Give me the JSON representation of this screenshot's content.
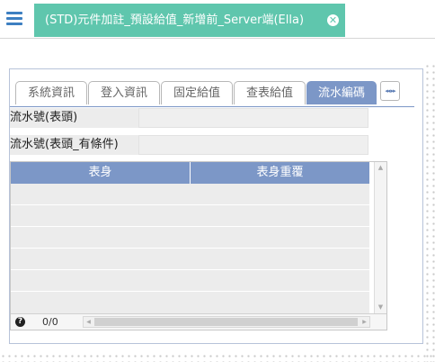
{
  "header": {
    "menu_icon": "hamburger-menu-icon",
    "tab_title": "(STD)元件加註_預設給值_新增前_Server端(Ella)",
    "close_icon": "close-circle-icon"
  },
  "tabs": [
    {
      "label": "系統資訊",
      "active": false
    },
    {
      "label": "登入資訊",
      "active": false
    },
    {
      "label": "固定給值",
      "active": false
    },
    {
      "label": "查表給值",
      "active": false
    },
    {
      "label": "流水編碼",
      "active": true
    }
  ],
  "tab_nav": {
    "arrows": "◂◂ ▸▸"
  },
  "fields": [
    {
      "label": "流水號(表頭)",
      "value": ""
    },
    {
      "label": "流水號(表頭_有條件)",
      "value": ""
    }
  ],
  "grid": {
    "columns": [
      "表身",
      "表身重覆"
    ],
    "rows": [],
    "pager": {
      "count": "0/0",
      "help_icon": "question-circle-icon"
    }
  },
  "colors": {
    "accent_tab": "#5fc6ad",
    "active_tab": "#7c97c7",
    "menu_icon": "#3d7fc1"
  }
}
